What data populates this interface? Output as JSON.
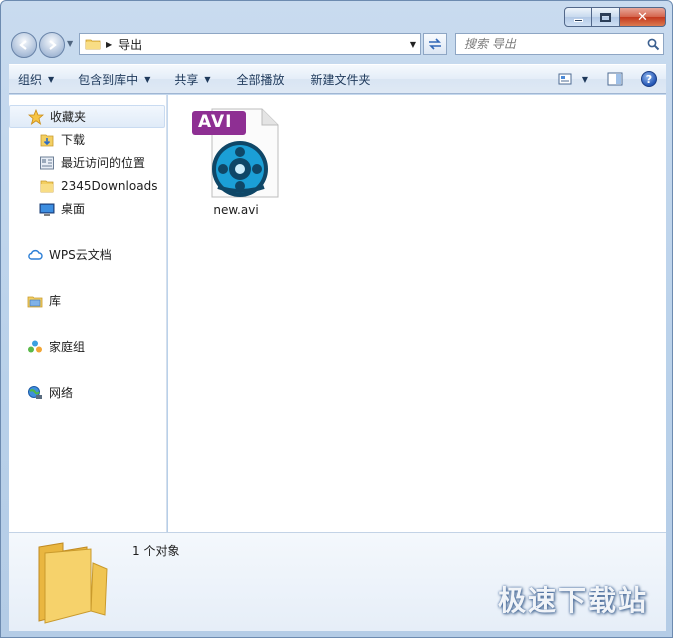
{
  "window": {
    "controls": {
      "minimize": "",
      "maximize": "",
      "close": "✕"
    }
  },
  "address": {
    "path_label": "导出",
    "search_placeholder": "搜索 导出"
  },
  "toolbar": {
    "items": [
      {
        "label": "组织",
        "has_menu": true
      },
      {
        "label": "包含到库中",
        "has_menu": true
      },
      {
        "label": "共享",
        "has_menu": true
      },
      {
        "label": "全部播放",
        "has_menu": false
      },
      {
        "label": "新建文件夹",
        "has_menu": false
      }
    ],
    "help_label": "?"
  },
  "nav_pane": {
    "favorites": {
      "label": "收藏夹",
      "icon": "star-icon"
    },
    "favorites_children": [
      {
        "label": "下载",
        "icon": "download-folder-icon"
      },
      {
        "label": "最近访问的位置",
        "icon": "recent-places-icon"
      },
      {
        "label": "2345Downloads",
        "icon": "folder-icon"
      },
      {
        "label": "桌面",
        "icon": "desktop-icon"
      }
    ],
    "wps_cloud": {
      "label": "WPS云文档",
      "icon": "cloud-icon"
    },
    "libraries": {
      "label": "库",
      "icon": "library-icon"
    },
    "homegroup": {
      "label": "家庭组",
      "icon": "homegroup-icon"
    },
    "network": {
      "label": "网络",
      "icon": "network-icon"
    }
  },
  "files": [
    {
      "name": "new.avi",
      "badge": "AVI",
      "icon": "avi-file-icon"
    }
  ],
  "details": {
    "summary": "1 个对象"
  },
  "watermark": "极速下载站",
  "colors": {
    "accent": "#2456b4",
    "avi_badge": "#8e2f93",
    "reel": "#1b9fd6"
  }
}
